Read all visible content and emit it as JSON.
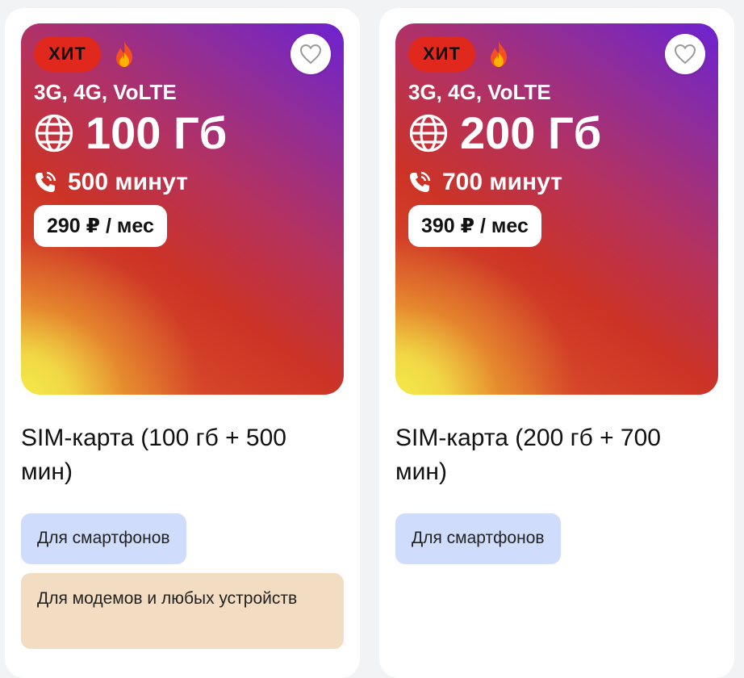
{
  "cards": [
    {
      "badge": "ХИТ",
      "tech": "3G, 4G, VoLTE",
      "data": "100 Гб",
      "minutes": "500 минут",
      "price": "290 ₽ / мес",
      "title": "SIM-карта (100 гб + 500 мин)",
      "tags": [
        "Для смартфонов",
        "Для модемов и любых устройств"
      ]
    },
    {
      "badge": "ХИТ",
      "tech": "3G, 4G, VoLTE",
      "data": "200 Гб",
      "minutes": "700 минут",
      "price": "390 ₽ / мес",
      "title": "SIM-карта (200 гб + 700 мин)",
      "tags": [
        "Для смартфонов"
      ]
    }
  ],
  "icons": {
    "favorite": "heart-icon",
    "hot": "fire-icon",
    "internet": "globe-icon",
    "calls": "phone-icon"
  },
  "colors": {
    "badge_red": "#e0281d",
    "tag_blue": "#cfdcfb",
    "tag_beige": "#f2dcc2"
  }
}
